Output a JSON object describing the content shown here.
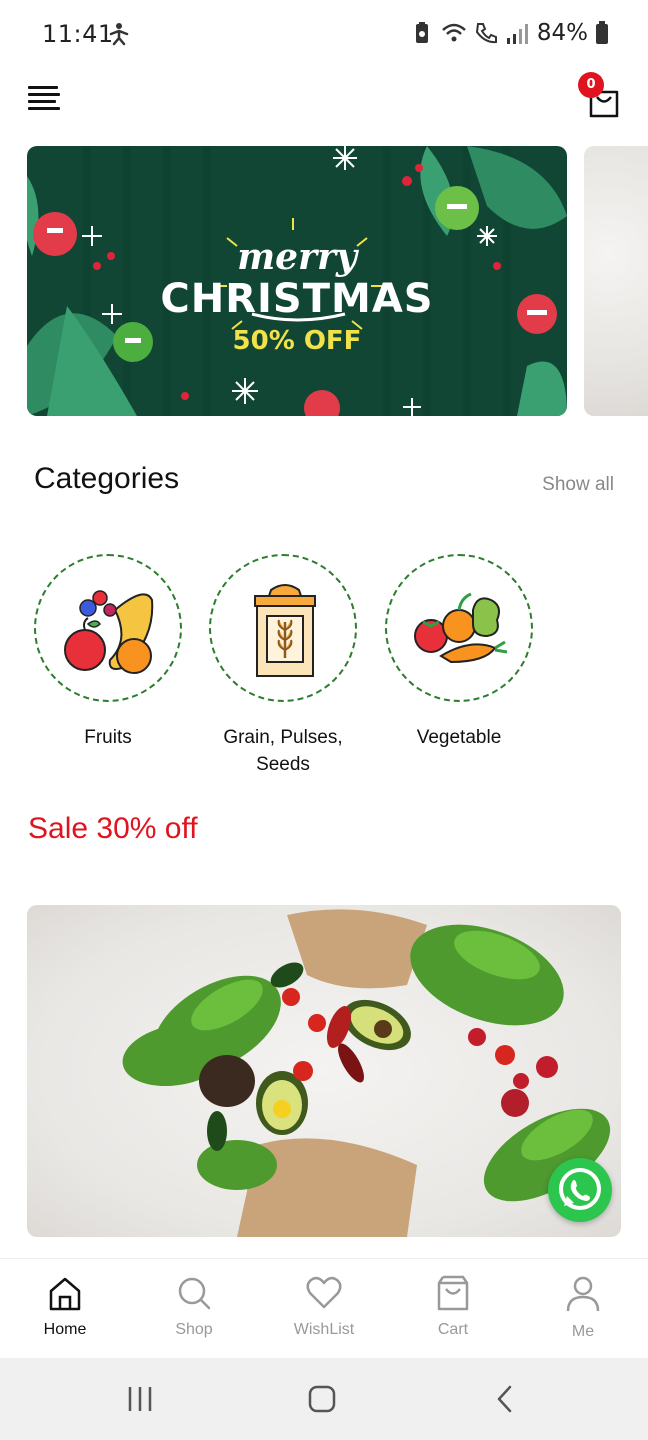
{
  "status_bar": {
    "time": "11:41",
    "battery": "84%"
  },
  "header": {
    "cart_count": "0"
  },
  "banner": {
    "line1": "merry",
    "line2": "CHRISTMAS",
    "offer": "50% OFF"
  },
  "categories": {
    "title": "Categories",
    "show_all": "Show all",
    "items": [
      {
        "label": "Fruits",
        "icon": "fruits-icon"
      },
      {
        "label": "Grain, Pulses, Seeds",
        "icon": "grain-sack-icon"
      },
      {
        "label": "Vegetable",
        "icon": "vegetables-icon"
      }
    ]
  },
  "sale": {
    "title": "Sale 30% off"
  },
  "bottom_nav": {
    "items": [
      {
        "label": "Home",
        "icon": "home-icon",
        "active": true
      },
      {
        "label": "Shop",
        "icon": "search-icon",
        "active": false
      },
      {
        "label": "WishList",
        "icon": "heart-icon",
        "active": false
      },
      {
        "label": "Cart",
        "icon": "shopping-bag-icon",
        "active": false
      },
      {
        "label": "Me",
        "icon": "user-icon",
        "active": false
      }
    ]
  },
  "colors": {
    "accent_red": "#e0141e",
    "category_ring": "#2e7d2e",
    "banner_green": "#114634",
    "whatsapp_green": "#2cc64f"
  }
}
